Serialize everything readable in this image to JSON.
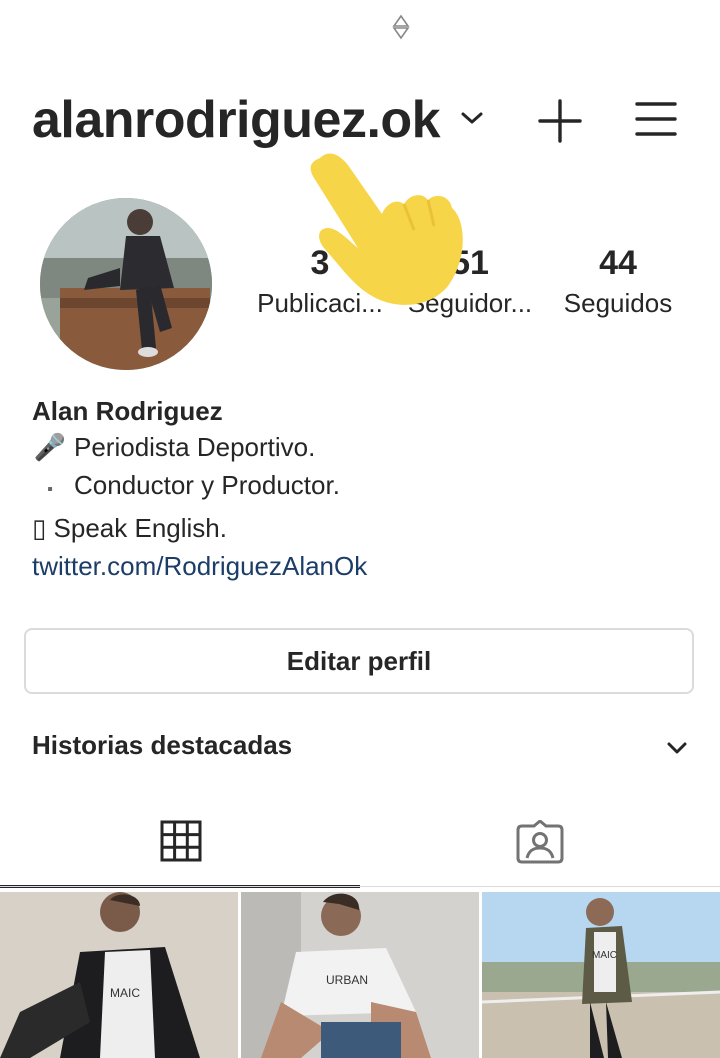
{
  "profile": {
    "username": "alanrodriguez.ok",
    "stats": [
      {
        "value": "3",
        "label": "Publicaci..."
      },
      {
        "value": "51",
        "label": "Seguidor..."
      },
      {
        "value": "44",
        "label": "Seguidos"
      }
    ]
  },
  "bio": {
    "name": "Alan Rodriguez",
    "lines": [
      {
        "icon": "🎤",
        "text": "Periodista Deportivo."
      },
      {
        "icon": "▪",
        "text": "Conductor y Productor."
      },
      {
        "icon": "▯",
        "text": "Speak English."
      }
    ],
    "link": "twitter.com/RodriguezAlanOk"
  },
  "actions": {
    "edit_profile": "Editar perfil"
  },
  "highlights": {
    "title": "Historias destacadas"
  },
  "tabs": [
    {
      "icon": "grid-icon",
      "active": true
    },
    {
      "icon": "tagged-person-icon",
      "active": false
    }
  ],
  "posts": [
    "post-1",
    "post-2",
    "post-3"
  ],
  "colors": {
    "link": "#1b3d68",
    "text": "#262626",
    "hand": "#f7d548",
    "border": "#dbdbdb"
  }
}
